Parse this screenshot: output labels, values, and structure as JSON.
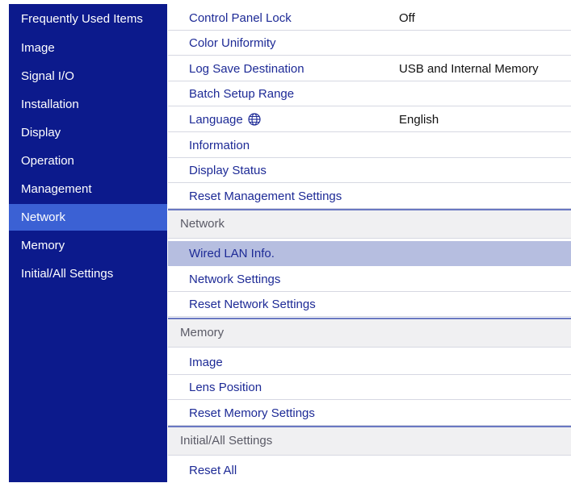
{
  "sidebar": {
    "items": [
      {
        "label": "Frequently Used Items"
      },
      {
        "label": "Image"
      },
      {
        "label": "Signal I/O"
      },
      {
        "label": "Installation"
      },
      {
        "label": "Display"
      },
      {
        "label": "Operation"
      },
      {
        "label": "Management"
      },
      {
        "label": "Network",
        "selected": true
      },
      {
        "label": "Memory"
      },
      {
        "label": "Initial/All Settings"
      }
    ]
  },
  "management": {
    "items": [
      {
        "label": "Control Panel Lock",
        "value": "Off"
      },
      {
        "label": "Color Uniformity"
      },
      {
        "label": "Log Save Destination",
        "value": "USB and Internal Memory"
      },
      {
        "label": "Batch Setup Range"
      },
      {
        "label": "Language",
        "value": "English",
        "icon": "globe-icon"
      },
      {
        "label": "Information"
      },
      {
        "label": "Display Status"
      },
      {
        "label": "Reset Management Settings"
      }
    ]
  },
  "network": {
    "header": "Network",
    "items": [
      {
        "label": "Wired LAN Info.",
        "highlighted": true
      },
      {
        "label": "Network Settings"
      },
      {
        "label": "Reset Network Settings"
      }
    ]
  },
  "memory": {
    "header": "Memory",
    "items": [
      {
        "label": "Image"
      },
      {
        "label": "Lens Position"
      },
      {
        "label": "Reset Memory Settings"
      }
    ]
  },
  "initial_all_settings": {
    "header": "Initial/All Settings",
    "items": [
      {
        "label": "Reset All"
      }
    ]
  },
  "colors": {
    "sidebar_bg": "#0c1a8c",
    "sidebar_selected": "#3b61d4",
    "row_highlight": "#b6bee0",
    "item_text": "#1d2a96"
  }
}
